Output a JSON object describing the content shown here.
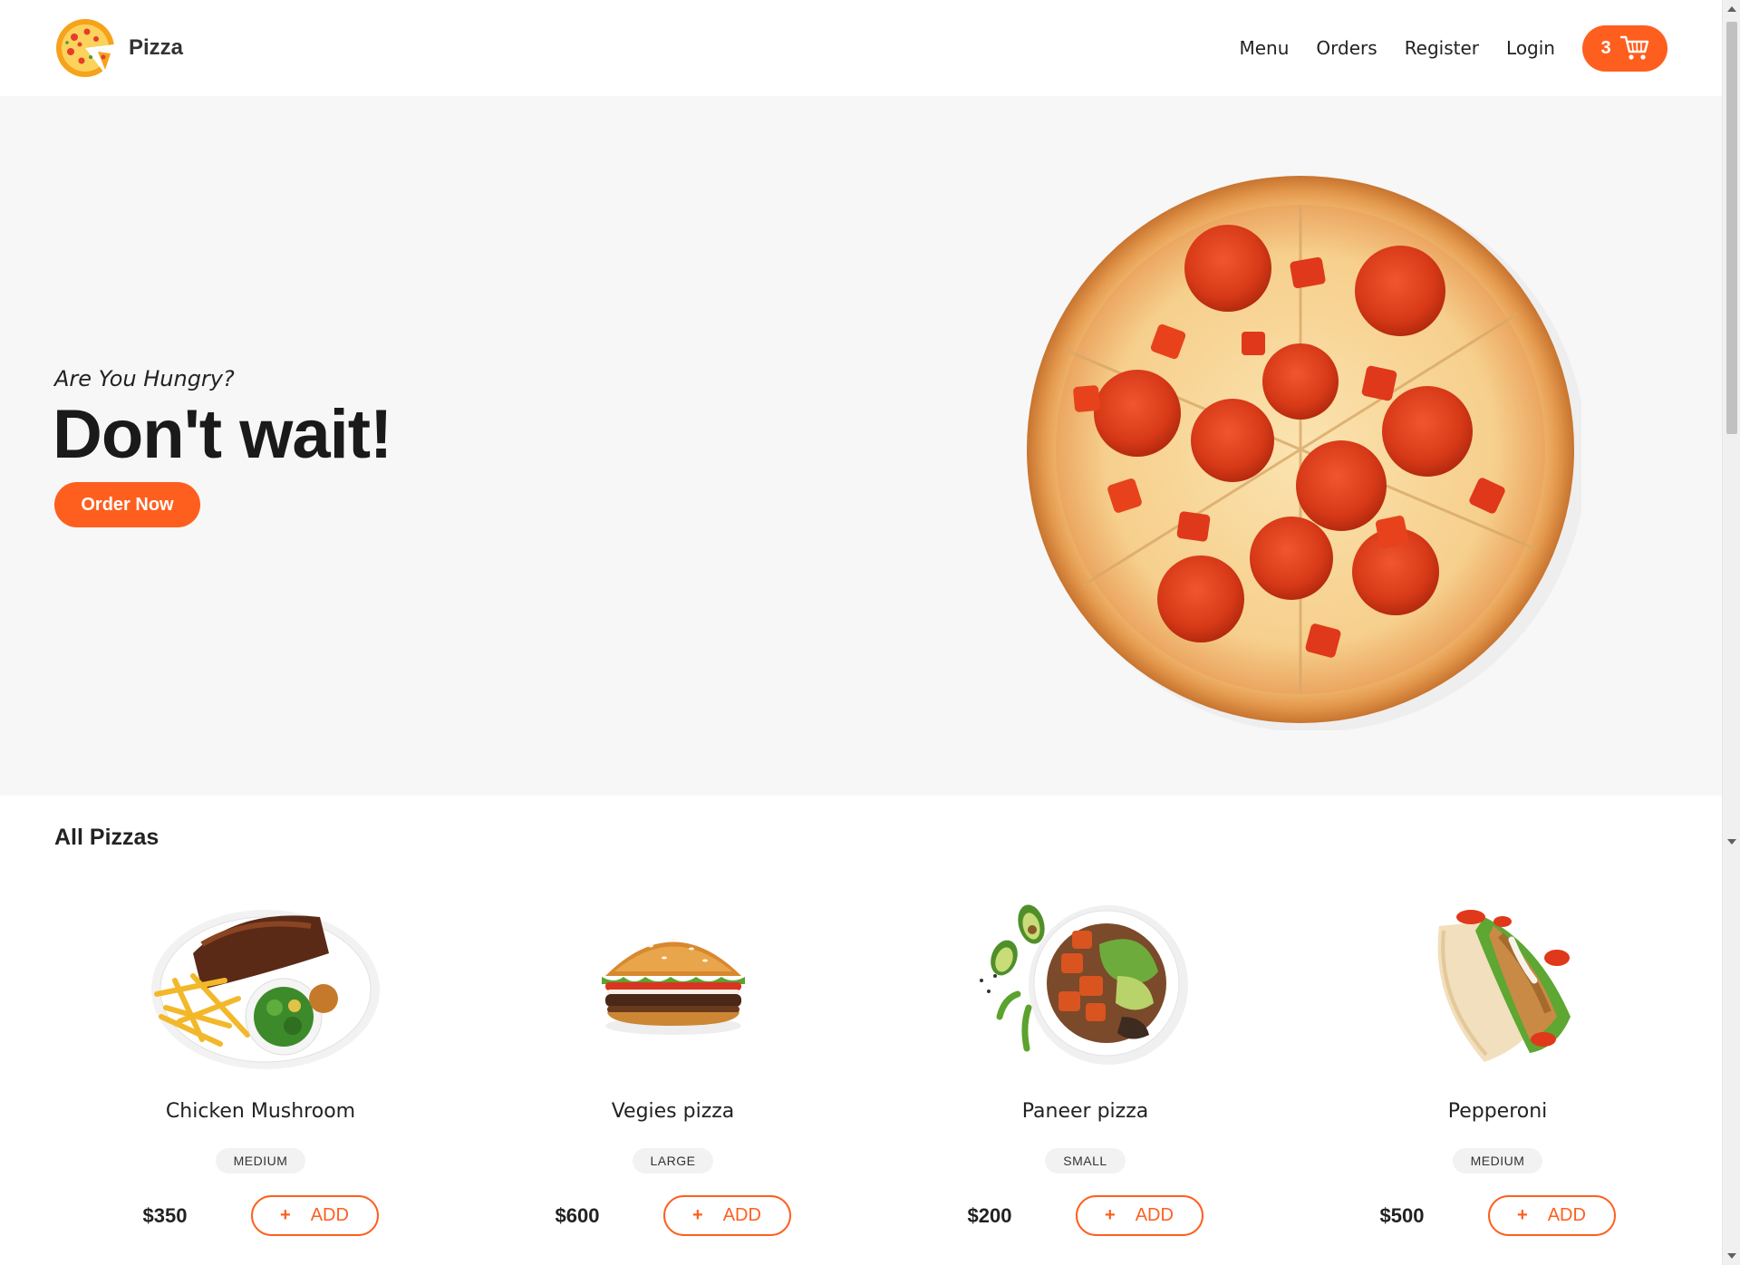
{
  "header": {
    "brand_name": "Pizza",
    "nav": [
      "Menu",
      "Orders",
      "Register",
      "Login"
    ],
    "cart_count": "3"
  },
  "hero": {
    "tagline": "Are You Hungry?",
    "headline": "Don't wait!",
    "cta_label": "Order Now"
  },
  "section": {
    "title": "All Pizzas"
  },
  "products": [
    {
      "name": "Chicken Mushroom",
      "size": "MEDIUM",
      "price": "$350",
      "add_label": "ADD",
      "add_icon": "+"
    },
    {
      "name": "Vegies pizza",
      "size": "LARGE",
      "price": "$600",
      "add_label": "ADD",
      "add_icon": "+"
    },
    {
      "name": "Paneer pizza",
      "size": "SMALL",
      "price": "$200",
      "add_label": "ADD",
      "add_icon": "+"
    },
    {
      "name": "Pepperoni",
      "size": "MEDIUM",
      "price": "$500",
      "add_label": "ADD",
      "add_icon": "+"
    }
  ],
  "colors": {
    "accent": "#fe5f1e",
    "hero_bg": "#f7f7f7",
    "badge_bg": "#f2f2f2"
  }
}
